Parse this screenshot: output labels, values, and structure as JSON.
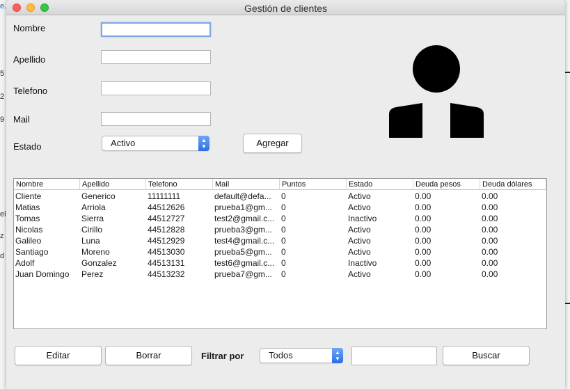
{
  "window": {
    "title": "Gestión de clientes"
  },
  "background": {
    "fragments": [
      "e.",
      "5",
      "2",
      "9",
      "el",
      "z",
      "d"
    ]
  },
  "form": {
    "nombre": {
      "label": "Nombre",
      "value": ""
    },
    "apellido": {
      "label": "Apellido",
      "value": ""
    },
    "telefono": {
      "label": "Telefono",
      "value": ""
    },
    "mail": {
      "label": "Mail",
      "value": ""
    },
    "estado": {
      "label": "Estado",
      "selected": "Activo"
    },
    "add_button": "Agregar"
  },
  "avatar": {
    "icon": "user-silhouette-icon",
    "color": "#000000"
  },
  "table": {
    "columns": [
      "Nombre",
      "Apellido",
      "Telefono",
      "Mail",
      "Puntos",
      "Estado",
      "Deuda pesos",
      "Deuda dólares"
    ],
    "rows": [
      [
        "Cliente",
        "Generico",
        "11111111",
        "default@defa...",
        "0",
        "Activo",
        "0.00",
        "0.00"
      ],
      [
        "Matias",
        "Arriola",
        "44512626",
        "prueba1@gm...",
        "0",
        "Activo",
        "0.00",
        "0.00"
      ],
      [
        "Tomas",
        "Sierra",
        "44512727",
        "test2@gmail.c...",
        "0",
        "Inactivo",
        "0.00",
        "0.00"
      ],
      [
        "Nicolas",
        "Cirillo",
        "44512828",
        "prueba3@gm...",
        "0",
        "Activo",
        "0.00",
        "0.00"
      ],
      [
        "Galileo",
        "Luna",
        "44512929",
        "test4@gmail.c...",
        "0",
        "Activo",
        "0.00",
        "0.00"
      ],
      [
        "Santiago",
        "Moreno",
        "44513030",
        "prueba5@gm...",
        "0",
        "Activo",
        "0.00",
        "0.00"
      ],
      [
        "Adolf",
        "Gonzalez",
        "44513131",
        "test6@gmail.c...",
        "0",
        "Inactivo",
        "0.00",
        "0.00"
      ],
      [
        "Juan Domingo",
        "Perez",
        "44513232",
        "prueba7@gm...",
        "0",
        "Activo",
        "0.00",
        "0.00"
      ]
    ]
  },
  "bottom": {
    "edit_button": "Editar",
    "delete_button": "Borrar",
    "filter_label": "Filtrar por",
    "filter_selected": "Todos",
    "search_value": "",
    "search_button": "Buscar"
  },
  "colors": {
    "window_bg": "#ececec",
    "focus": "#7fa8e3",
    "select_accent": "#2a6fe3"
  }
}
